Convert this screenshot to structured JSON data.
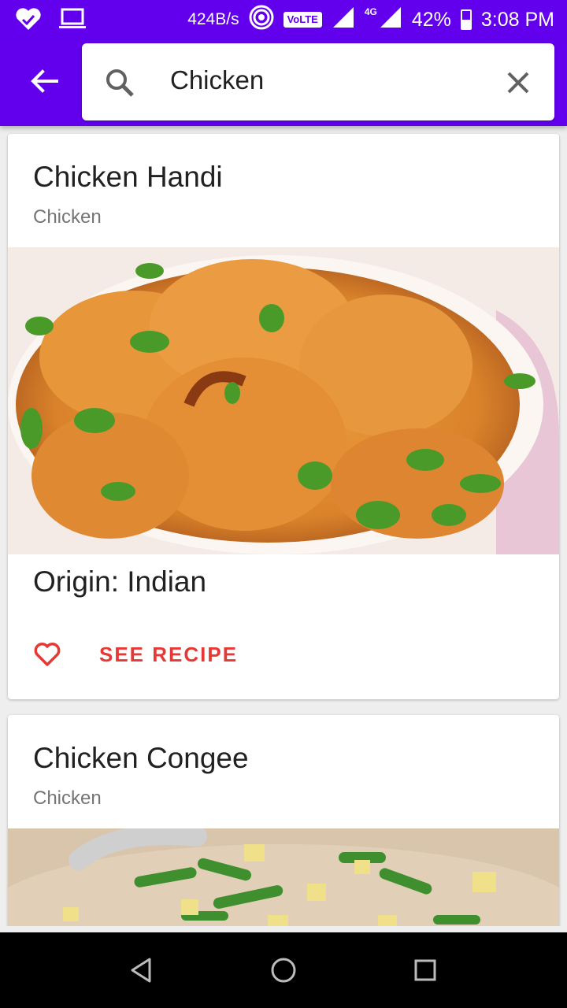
{
  "status": {
    "speed": "424B/s",
    "volte": "VoLTE",
    "network": "4G",
    "battery": "42%",
    "time": "3:08 PM",
    "icons": [
      "heart-check-icon",
      "laptop-icon",
      "hotspot-icon",
      "signal-icon",
      "battery-icon"
    ]
  },
  "search": {
    "query": "Chicken",
    "icons": {
      "back": "back-arrow-icon",
      "search": "search-icon",
      "clear": "close-icon"
    }
  },
  "recipes": [
    {
      "title": "Chicken Handi",
      "category": "Chicken",
      "origin": "Origin: Indian",
      "action_label": "SEE RECIPE",
      "favorite_icon": "heart-outline-icon"
    },
    {
      "title": "Chicken Congee",
      "category": "Chicken"
    }
  ],
  "colors": {
    "primary": "#6200ee",
    "accent": "#e53935",
    "background": "#eeeeee"
  },
  "navigation": {
    "icons": [
      "back-triangle-icon",
      "home-circle-icon",
      "recents-square-icon"
    ]
  }
}
